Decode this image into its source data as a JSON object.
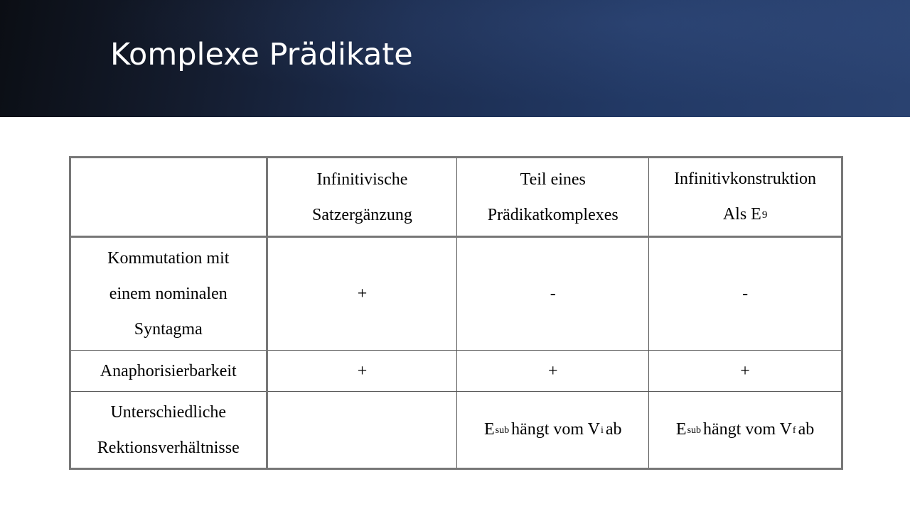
{
  "slide": {
    "title": "Komplexe Prädikate"
  },
  "table": {
    "header": {
      "col1_line1": "Infinitivische",
      "col1_line2": "Satzergänzung",
      "col2_line1": "Teil eines",
      "col2_line2": "Prädikatkomplexes",
      "col3_line1": "Infinitivkonstruktion",
      "col3_line2": "Als E",
      "col3_sub": "9"
    },
    "rows": [
      {
        "label_line1": "Kommutation mit",
        "label_line2": "einem nominalen",
        "label_line3": "Syntagma",
        "c1": "+",
        "c2": "-",
        "c3": "-"
      },
      {
        "label": "Anaphorisierbarkeit",
        "c1": "+",
        "c2": "+",
        "c3": "+"
      },
      {
        "label_line1": "Unterschiedliche",
        "label_line2": "Rektionsverhältnisse",
        "c1": "",
        "c2": {
          "e": "E",
          "e_sub": "sub",
          "mid": "hängt vom V",
          "v_sub": "i",
          "end": "ab"
        },
        "c3": {
          "e": "E",
          "e_sub": "sub",
          "mid": "hängt vom V",
          "v_sub": "f",
          "end": "ab"
        }
      }
    ]
  },
  "colors": {
    "header_band_dark": "#0b0e14",
    "header_band_blue": "#2a4270",
    "title_text": "#ffffff",
    "table_border": "#555555"
  }
}
